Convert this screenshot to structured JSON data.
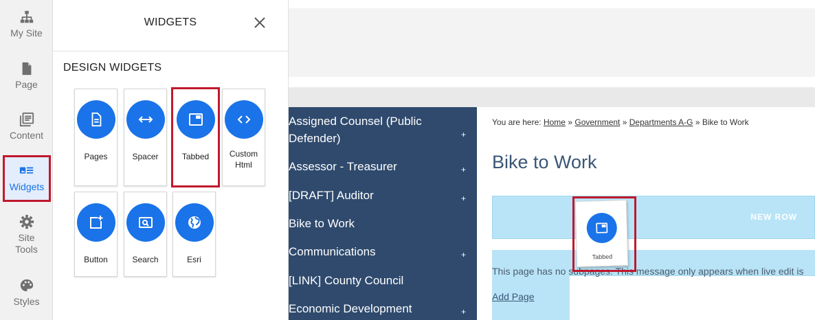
{
  "rail": {
    "items": [
      {
        "label": "My Site",
        "icon": "sitemap-icon"
      },
      {
        "label": "Page",
        "icon": "page-icon"
      },
      {
        "label": "Content",
        "icon": "content-icon"
      },
      {
        "label": "Widgets",
        "icon": "widgets-icon"
      },
      {
        "label": "Site",
        "label2": "Tools",
        "icon": "gear-icon"
      },
      {
        "label": "Styles",
        "icon": "palette-icon"
      }
    ],
    "active_color": "#1a73e8"
  },
  "panel": {
    "title": "WIDGETS",
    "section": "DESIGN WIDGETS",
    "widgets": [
      {
        "label": "Pages",
        "icon": "document-icon"
      },
      {
        "label": "Spacer",
        "icon": "arrows-horizontal-icon"
      },
      {
        "label": "Tabbed",
        "icon": "tab-icon"
      },
      {
        "label": "Custom",
        "label2": "Html",
        "icon": "code-icon"
      },
      {
        "label": "Button",
        "icon": "add-box-icon"
      },
      {
        "label": "Search",
        "icon": "search-icon"
      },
      {
        "label": "Esri",
        "icon": "globe-icon"
      }
    ]
  },
  "nav": {
    "items": [
      {
        "label": "Assigned Counsel (Public Defender)",
        "plus": "+"
      },
      {
        "label": "Assessor - Treasurer",
        "plus": "+"
      },
      {
        "label": "[DRAFT] Auditor",
        "plus": "+"
      },
      {
        "label": "Bike to Work",
        "plus": ""
      },
      {
        "label": "Communications",
        "plus": "+"
      },
      {
        "label": "[LINK] County Council",
        "plus": ""
      },
      {
        "label": "Economic Development",
        "plus": "+"
      }
    ],
    "background": "#2f4a6d"
  },
  "breadcrumb": {
    "prefix": "You are here:",
    "links": [
      "Home",
      " Government",
      " Departments A-G"
    ],
    "separator": "»",
    "current": "Bike to Work"
  },
  "page_title": "Bike to Work",
  "new_row_label": "NEW ROW",
  "message": "This page has no subpages. This message only appears when live edit is",
  "add_page": "Add Page",
  "drag_ghost": {
    "label": "Tabbed"
  },
  "highlight_color": "#c0182c"
}
